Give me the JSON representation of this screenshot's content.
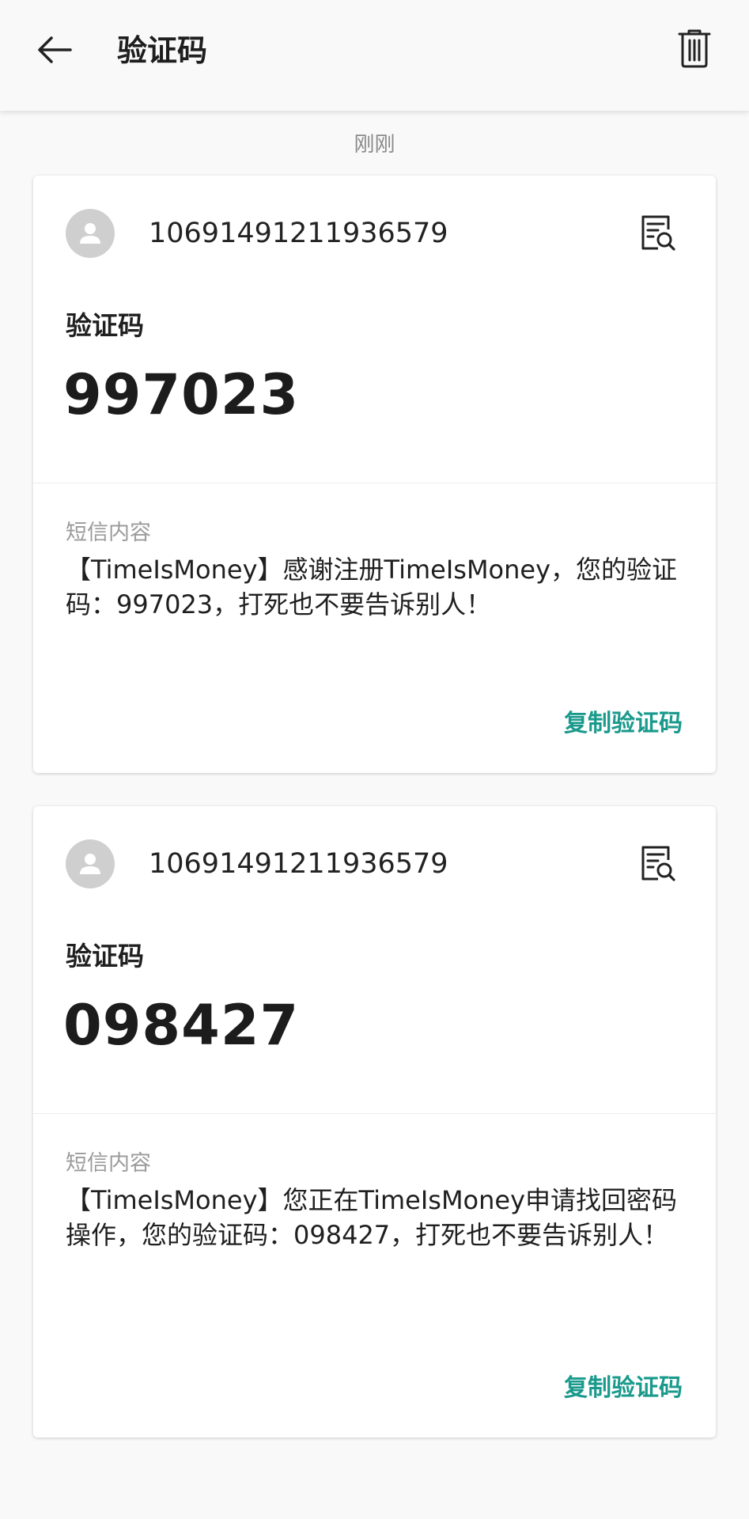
{
  "header": {
    "title": "验证码",
    "back_icon": "arrow-left-icon",
    "delete_icon": "trash-icon"
  },
  "timestamp": "刚刚",
  "messages": [
    {
      "sender": "10691491211936579",
      "code_label": "验证码",
      "code": "997023",
      "content_label": "短信内容",
      "content": "【TimeIsMoney】感谢注册TimeIsMoney，您的验证码：997023，打死也不要告诉别人！",
      "copy_label": "复制验证码"
    },
    {
      "sender": "10691491211936579",
      "code_label": "验证码",
      "code": "098427",
      "content_label": "短信内容",
      "content": "【TimeIsMoney】您正在TimeIsMoney申请找回密码操作，您的验证码：098427，打死也不要告诉别人！",
      "copy_label": "复制验证码"
    }
  ],
  "colors": {
    "accent": "#1a9a8c",
    "background": "#f9f9f9",
    "avatar": "#cfcfcf"
  }
}
